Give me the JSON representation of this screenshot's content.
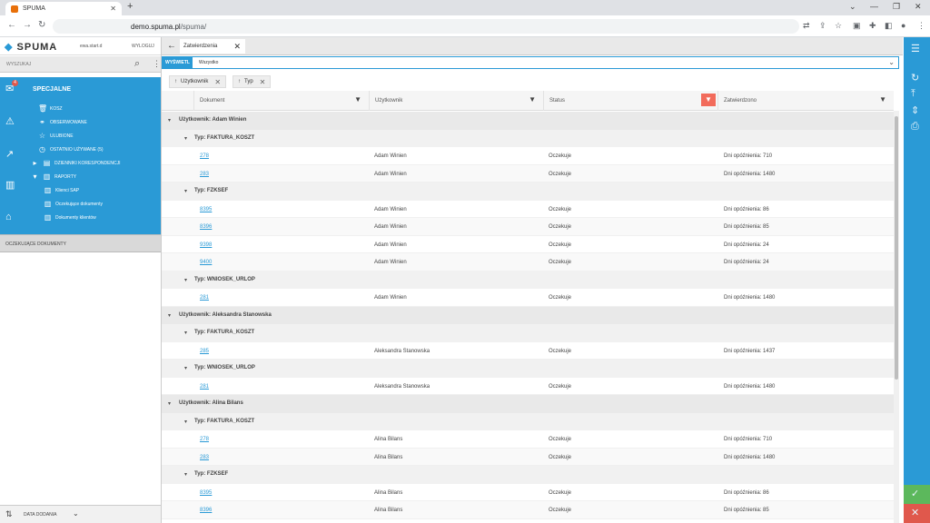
{
  "browser": {
    "tab_title": "SPUMA",
    "url_host": "demo.spuma.pl",
    "url_path": "/spuma/"
  },
  "app": {
    "logo_text": "SPUMA",
    "user": "ewa.start.d",
    "logout": "WYLOGUJ",
    "search_placeholder": "WYSZUKAJ",
    "notification_count": "4"
  },
  "menu": {
    "title": "SPECJALNE",
    "items": [
      {
        "label": "KOSZ",
        "icon": "trash-icon"
      },
      {
        "label": "OBSERWOWANE",
        "icon": "binoculars-icon"
      },
      {
        "label": "ULUBIONE",
        "icon": "star-icon"
      },
      {
        "label": "OSTATNIO UŻYWANE (5)",
        "icon": "clock-icon"
      },
      {
        "label": "DZIENNIKI KORESPONDENCJI",
        "icon": "journal-icon"
      },
      {
        "label": "RAPORTY",
        "icon": "chart-icon"
      }
    ],
    "subitems": [
      {
        "label": "Klienci SAP"
      },
      {
        "label": "Oczekujące dokumenty"
      },
      {
        "label": "Dokumenty klientów"
      }
    ],
    "pending_section": "OCZEKUJĄCE DOKUMENTY",
    "bottom_label": "DATA DODANIA"
  },
  "doc_tab": {
    "label": "Zatwierdzenia"
  },
  "filter": {
    "label": "WYŚWIETL",
    "value": "Wszystko"
  },
  "chips": [
    "Użytkownik",
    "Typ"
  ],
  "columns": [
    "Dokument",
    "Użytkownik",
    "Status",
    "Zatwierdzono"
  ],
  "groups": [
    {
      "user_label": "Użytkownik: Adam Winien",
      "types": [
        {
          "type_label": "Typ: FAKTURA_KOSZT",
          "rows": [
            {
              "doc": "278",
              "user": "Adam Winien",
              "status": "Oczekuje",
              "approved": "Dni opóźnienia: 710"
            },
            {
              "doc": "283",
              "user": "Adam Winien",
              "status": "Oczekuje",
              "approved": "Dni opóźnienia: 1480"
            }
          ]
        },
        {
          "type_label": "Typ: FZKSEF",
          "rows": [
            {
              "doc": "8395",
              "user": "Adam Winien",
              "status": "Oczekuje",
              "approved": "Dni opóźnienia: 86"
            },
            {
              "doc": "8396",
              "user": "Adam Winien",
              "status": "Oczekuje",
              "approved": "Dni opóźnienia: 85"
            },
            {
              "doc": "9398",
              "user": "Adam Winien",
              "status": "Oczekuje",
              "approved": "Dni opóźnienia: 24"
            },
            {
              "doc": "9400",
              "user": "Adam Winien",
              "status": "Oczekuje",
              "approved": "Dni opóźnienia: 24"
            }
          ]
        },
        {
          "type_label": "Typ: WNIOSEK_URLOP",
          "rows": [
            {
              "doc": "281",
              "user": "Adam Winien",
              "status": "Oczekuje",
              "approved": "Dni opóźnienia: 1480"
            }
          ]
        }
      ]
    },
    {
      "user_label": "Użytkownik: Aleksandra Stanowska",
      "types": [
        {
          "type_label": "Typ: FAKTURA_KOSZT",
          "rows": [
            {
              "doc": "285",
              "user": "Aleksandra Stanowska",
              "status": "Oczekuje",
              "approved": "Dni opóźnienia: 1437"
            }
          ]
        },
        {
          "type_label": "Typ: WNIOSEK_URLOP",
          "rows": [
            {
              "doc": "281",
              "user": "Aleksandra Stanowska",
              "status": "Oczekuje",
              "approved": "Dni opóźnienia: 1480"
            }
          ]
        }
      ]
    },
    {
      "user_label": "Użytkownik: Alina Bilans",
      "types": [
        {
          "type_label": "Typ: FAKTURA_KOSZT",
          "rows": [
            {
              "doc": "278",
              "user": "Alina Bilans",
              "status": "Oczekuje",
              "approved": "Dni opóźnienia: 710"
            },
            {
              "doc": "283",
              "user": "Alina Bilans",
              "status": "Oczekuje",
              "approved": "Dni opóźnienia: 1480"
            }
          ]
        },
        {
          "type_label": "Typ: FZKSEF",
          "rows": [
            {
              "doc": "8395",
              "user": "Alina Bilans",
              "status": "Oczekuje",
              "approved": "Dni opóźnienia: 86"
            },
            {
              "doc": "8396",
              "user": "Alina Bilans",
              "status": "Oczekuje",
              "approved": "Dni opóźnienia: 85"
            }
          ]
        }
      ]
    }
  ],
  "colors": {
    "accent": "#2a9ad6",
    "filter_active": "#f26b5b",
    "approve": "#5cb85c",
    "reject": "#e0584c"
  }
}
